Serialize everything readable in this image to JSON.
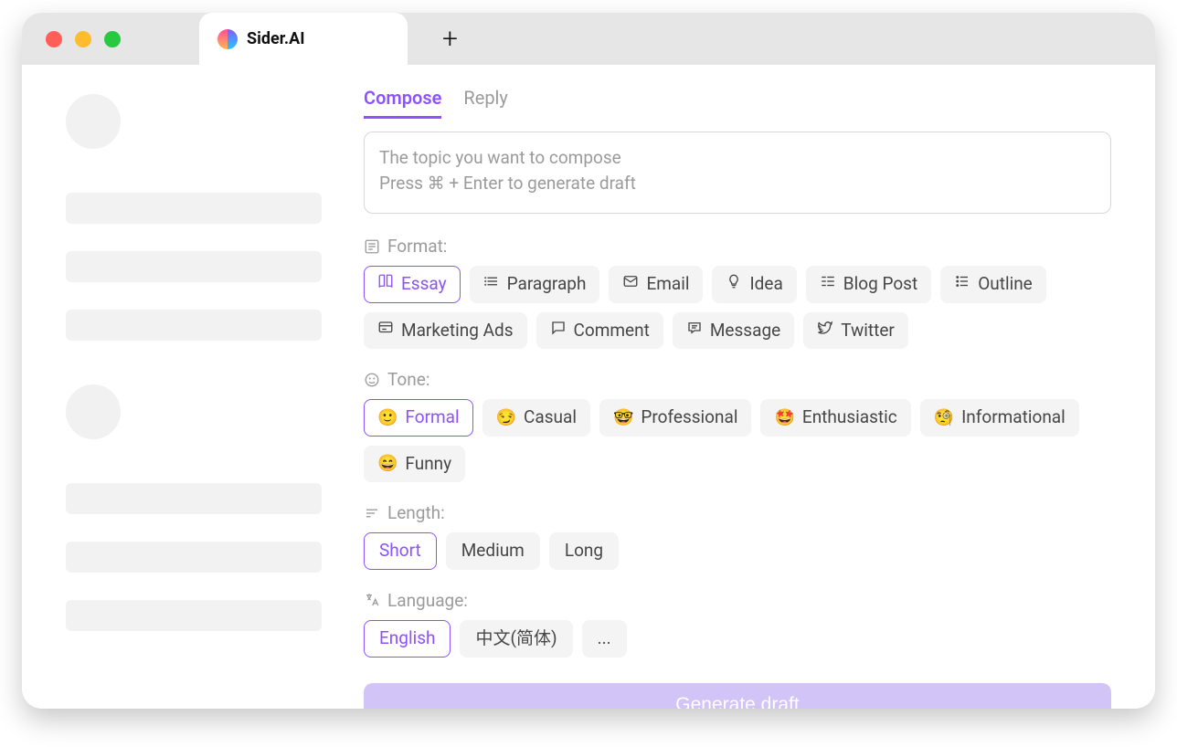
{
  "window": {
    "tab_title": "Sider.AI"
  },
  "mode_tabs": {
    "compose": "Compose",
    "reply": "Reply",
    "active": "compose"
  },
  "topic": {
    "value": "",
    "placeholder": "The topic you want to compose\nPress ⌘ + Enter to generate draft"
  },
  "sections": {
    "format": {
      "label": "Format:",
      "icon": "list-box-icon",
      "selected": "Essay",
      "options": [
        {
          "label": "Essay",
          "icon": "book-icon"
        },
        {
          "label": "Paragraph",
          "icon": "list-icon"
        },
        {
          "label": "Email",
          "icon": "mail-icon"
        },
        {
          "label": "Idea",
          "icon": "lightbulb-icon"
        },
        {
          "label": "Blog Post",
          "icon": "blog-icon"
        },
        {
          "label": "Outline",
          "icon": "outline-icon"
        },
        {
          "label": "Marketing Ads",
          "icon": "ads-icon"
        },
        {
          "label": "Comment",
          "icon": "comment-icon"
        },
        {
          "label": "Message",
          "icon": "message-icon"
        },
        {
          "label": "Twitter",
          "icon": "twitter-icon"
        }
      ]
    },
    "tone": {
      "label": "Tone:",
      "icon": "face-icon",
      "selected": "Formal",
      "options": [
        {
          "label": "Formal",
          "emoji": "🙂"
        },
        {
          "label": "Casual",
          "emoji": "😏"
        },
        {
          "label": "Professional",
          "emoji": "🤓"
        },
        {
          "label": "Enthusiastic",
          "emoji": "🤩"
        },
        {
          "label": "Informational",
          "emoji": "🧐"
        },
        {
          "label": "Funny",
          "emoji": "😄"
        }
      ]
    },
    "length": {
      "label": "Length:",
      "icon": "length-icon",
      "selected": "Short",
      "options": [
        {
          "label": "Short"
        },
        {
          "label": "Medium"
        },
        {
          "label": "Long"
        }
      ]
    },
    "language": {
      "label": "Language:",
      "icon": "translate-icon",
      "selected": "English",
      "options": [
        {
          "label": "English"
        },
        {
          "label": "中文(简体)"
        },
        {
          "label": "..."
        }
      ]
    }
  },
  "actions": {
    "generate": "Generate draft"
  }
}
